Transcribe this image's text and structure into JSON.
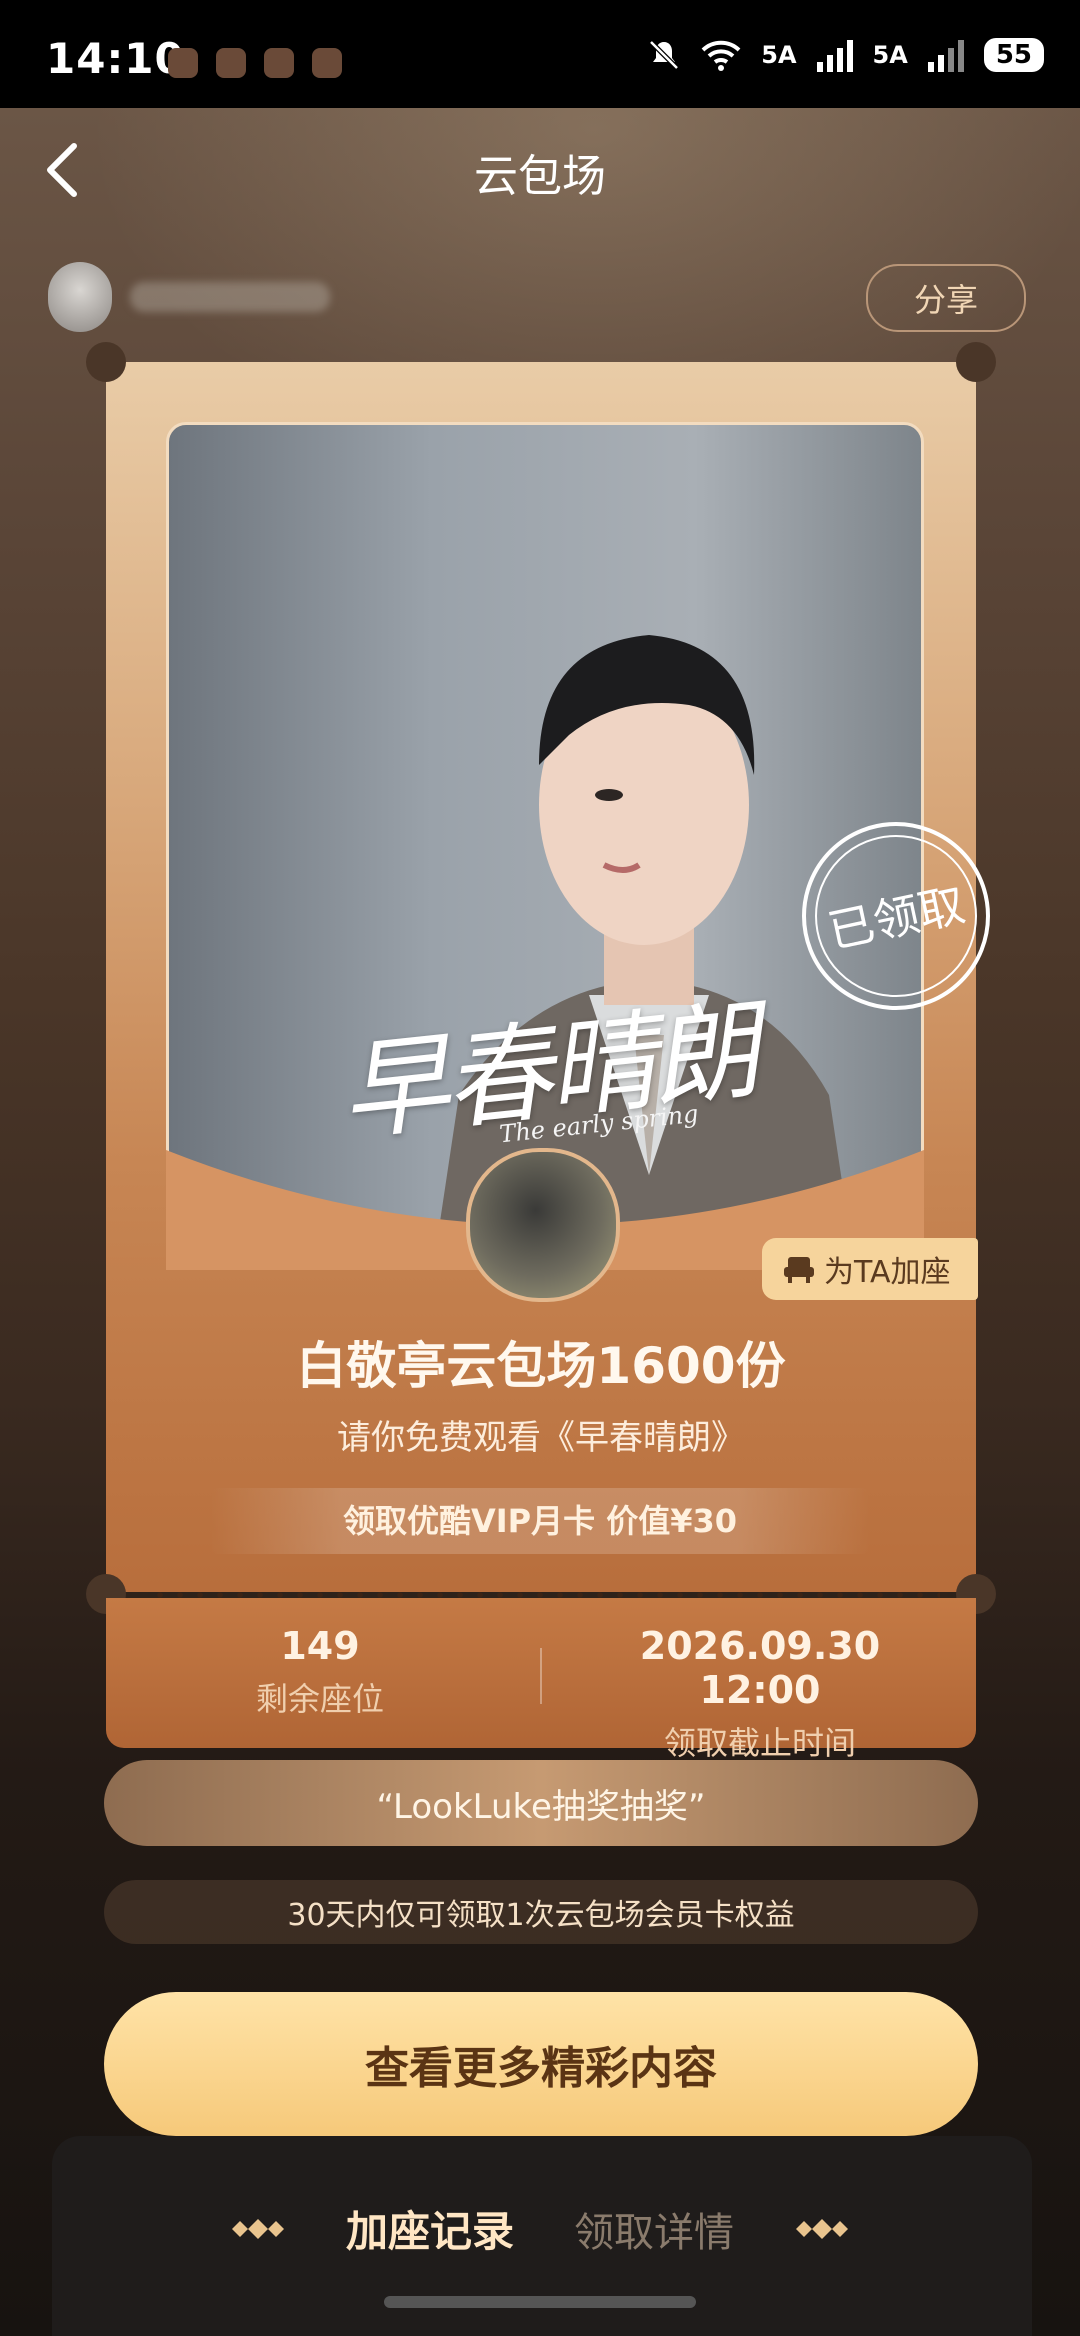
{
  "status_bar": {
    "time": "14:10",
    "network": "5A",
    "battery": "55"
  },
  "nav": {
    "title": "云包场",
    "share_label": "分享"
  },
  "ticket": {
    "poster_title": "早春晴朗",
    "poster_subtitle": "The early spring",
    "stamp_text": "已领取",
    "add_seat_label": "为TA加座",
    "main_title": "白敬亭云包场1600份",
    "subtitle": "请你免费观看《早春晴朗》",
    "vip_offer": "领取优酷VIP月卡 价值¥30",
    "remaining_seats": "149",
    "remaining_seats_label": "剩余座位",
    "deadline": "2026.09.30 12:00",
    "deadline_label": "领取截止时间"
  },
  "quote": "“LookLuke抽奖抽奖”",
  "limit_notice": "30天内仅可领取1次云包场会员卡权益",
  "cta_label": "查看更多精彩内容",
  "tabs": [
    {
      "label": "加座记录",
      "active": true
    },
    {
      "label": "领取详情",
      "active": false
    }
  ],
  "colors": {
    "accent": "#f6c97a",
    "ticket": "#c78654",
    "background": "#3a2a20"
  }
}
